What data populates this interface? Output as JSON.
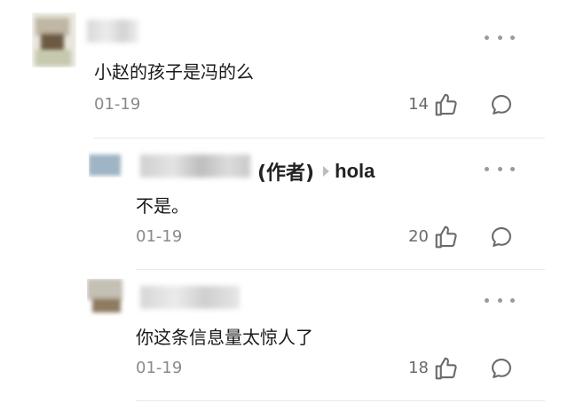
{
  "comments": [
    {
      "text": "小赵的孩子是冯的么",
      "date": "01-19",
      "likes": "14",
      "icons": [
        "more-icon",
        "thumbs-up-icon",
        "reply-bubble-icon"
      ]
    },
    {
      "author_tag": "(作者)",
      "reply_to": "hola",
      "text": "不是。",
      "date": "01-19",
      "likes": "20",
      "icons": [
        "more-icon",
        "caret-right-icon",
        "thumbs-up-icon",
        "reply-bubble-icon"
      ]
    },
    {
      "text": "你这条信息量太惊人了",
      "date": "01-19",
      "likes": "18",
      "icons": [
        "more-icon",
        "thumbs-up-icon",
        "reply-bubble-icon"
      ]
    }
  ],
  "colors": {
    "text": "#1a1a1a",
    "muted": "#8a8a8a",
    "icon": "#6a6a6a",
    "divider": "#e9e9e9"
  }
}
